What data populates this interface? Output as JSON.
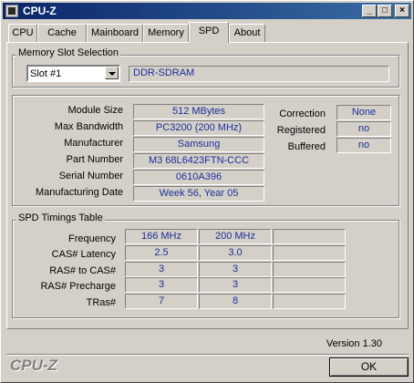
{
  "window": {
    "title": "CPU-Z"
  },
  "titlebar": {
    "minimize_glyph": "_",
    "maximize_glyph": "□",
    "close_glyph": "×"
  },
  "tabs": [
    {
      "label": "CPU",
      "active": false
    },
    {
      "label": "Cache",
      "active": false
    },
    {
      "label": "Mainboard",
      "active": false
    },
    {
      "label": "Memory",
      "active": false
    },
    {
      "label": "SPD",
      "active": true
    },
    {
      "label": "About",
      "active": false
    }
  ],
  "slot_selection": {
    "group_label": "Memory Slot Selection",
    "slot_value": "Slot #1",
    "memory_type": "DDR-SDRAM"
  },
  "module": {
    "rows": [
      {
        "label": "Module Size",
        "value": "512 MBytes"
      },
      {
        "label": "Max Bandwidth",
        "value": "PC3200 (200 MHz)"
      },
      {
        "label": "Manufacturer",
        "value": "Samsung"
      },
      {
        "label": "Part Number",
        "value": "M3 68L6423FTN-CCC"
      },
      {
        "label": "Serial Number",
        "value": "0610A396"
      },
      {
        "label": "Manufacturing Date",
        "value": "Week 56, Year 05"
      }
    ],
    "flags": [
      {
        "label": "Correction",
        "value": "None"
      },
      {
        "label": "Registered",
        "value": "no"
      },
      {
        "label": "Buffered",
        "value": "no"
      }
    ]
  },
  "timings": {
    "group_label": "SPD Timings Table",
    "rows": [
      {
        "label": "Frequency",
        "values": [
          "166 MHz",
          "200 MHz",
          ""
        ]
      },
      {
        "label": "CAS# Latency",
        "values": [
          "2.5",
          "3.0",
          ""
        ]
      },
      {
        "label": "RAS# to CAS#",
        "values": [
          "3",
          "3",
          ""
        ]
      },
      {
        "label": "RAS# Precharge",
        "values": [
          "3",
          "3",
          ""
        ]
      },
      {
        "label": "TRas#",
        "values": [
          "7",
          "8",
          ""
        ]
      }
    ]
  },
  "footer": {
    "version": "Version 1.30",
    "brand": "CPU-Z",
    "ok_label": "OK"
  }
}
